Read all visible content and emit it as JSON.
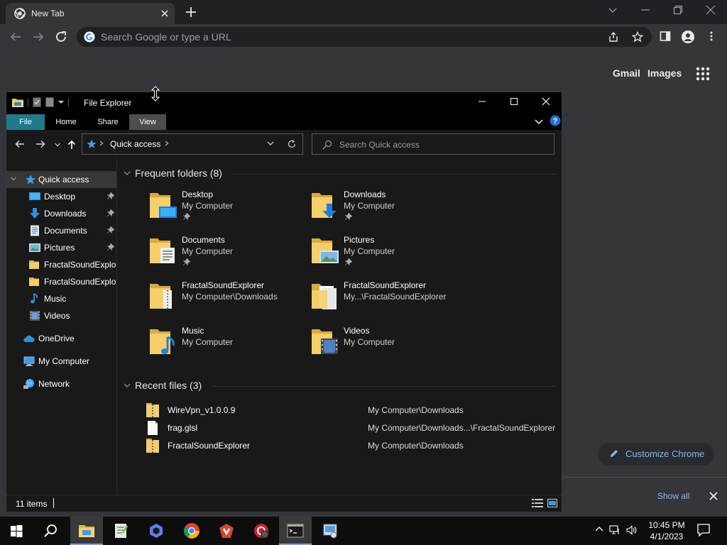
{
  "chrome": {
    "tab_title": "New Tab",
    "omnibox_placeholder": "Search Google or type a URL",
    "ntp_links": [
      "Gmail",
      "Images"
    ],
    "customize_label": "Customize Chrome",
    "downloads_show_all": "Show all",
    "accent_color": "#8ab4f8"
  },
  "explorer": {
    "title": "File Explorer",
    "ribbon_tabs": [
      "File",
      "Home",
      "Share",
      "View"
    ],
    "address": "Quick access",
    "search_placeholder": "Search Quick access",
    "nav": [
      {
        "label": "Quick access",
        "icon": "star-icon",
        "selected": true,
        "expanded": true
      },
      {
        "label": "Desktop",
        "icon": "desktop-icon",
        "pinned": true
      },
      {
        "label": "Downloads",
        "icon": "downloads-icon",
        "pinned": true
      },
      {
        "label": "Documents",
        "icon": "documents-icon",
        "pinned": true
      },
      {
        "label": "Pictures",
        "icon": "pictures-icon",
        "pinned": true
      },
      {
        "label": "FractalSoundExplorer",
        "icon": "folder-icon"
      },
      {
        "label": "FractalSoundExplorer",
        "icon": "folder-icon"
      },
      {
        "label": "Music",
        "icon": "music-icon"
      },
      {
        "label": "Videos",
        "icon": "videos-icon"
      },
      {
        "label": "OneDrive",
        "icon": "cloud-icon"
      },
      {
        "label": "My Computer",
        "icon": "computer-icon"
      },
      {
        "label": "Network",
        "icon": "network-icon"
      }
    ],
    "frequent_header": "Frequent folders (8)",
    "frequent": [
      {
        "name": "Desktop",
        "location": "My Computer",
        "pinned": true,
        "icon": "desktop-folder-icon"
      },
      {
        "name": "Downloads",
        "location": "My Computer",
        "pinned": true,
        "icon": "downloads-folder-icon"
      },
      {
        "name": "Documents",
        "location": "My Computer",
        "pinned": true,
        "icon": "documents-folder-icon"
      },
      {
        "name": "Pictures",
        "location": "My Computer",
        "pinned": true,
        "icon": "pictures-folder-icon"
      },
      {
        "name": "FractalSoundExplorer",
        "location": "My Computer\\Downloads",
        "pinned": false,
        "icon": "zip-folder-icon"
      },
      {
        "name": "FractalSoundExplorer",
        "location": "My...\\FractalSoundExplorer",
        "pinned": false,
        "icon": "folder-icon"
      },
      {
        "name": "Music",
        "location": "My Computer",
        "pinned": false,
        "icon": "music-folder-icon"
      },
      {
        "name": "Videos",
        "location": "My Computer",
        "pinned": false,
        "icon": "videos-folder-icon"
      }
    ],
    "recent_header": "Recent files (3)",
    "recent": [
      {
        "name": "WireVpn_v1.0.0.9",
        "location": "My Computer\\Downloads",
        "icon": "zip-icon"
      },
      {
        "name": "frag.glsl",
        "location": "My Computer\\Downloads...\\FractalSoundExplorer",
        "icon": "file-icon"
      },
      {
        "name": "FractalSoundExplorer",
        "location": "My Computer\\Downloads",
        "icon": "zip-icon"
      }
    ],
    "status": "11 items",
    "accent_color": "#1f7a8c"
  },
  "taskbar": {
    "apps": [
      "start-icon",
      "search-icon",
      "file-explorer-icon",
      "notepad-plus-icon",
      "app-icon",
      "chrome-icon",
      "malwarebytes-icon",
      "security-icon",
      "terminal-icon",
      "control-panel-icon"
    ],
    "time": "10:45 PM",
    "date": "4/1/2023"
  }
}
